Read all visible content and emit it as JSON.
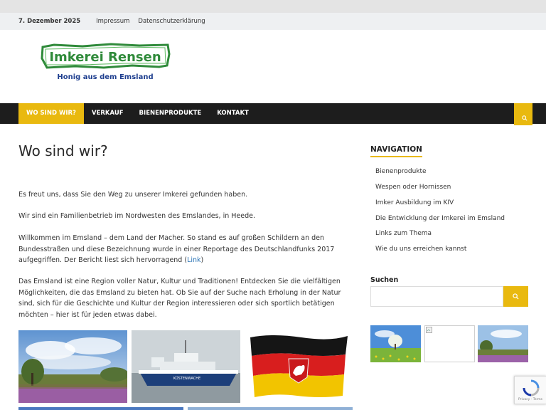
{
  "topbar": {
    "date": "7. Dezember 2025",
    "links": [
      "Impressum",
      "Datenschutzerklärung"
    ]
  },
  "logo": {
    "name": "Imkerei Rensen",
    "tagline": "Honig aus dem Emsland"
  },
  "nav": {
    "items": [
      "WO SIND WIR?",
      "VERKAUF",
      "BIENENPRODUKTE",
      "KONTAKT"
    ],
    "active_index": 0
  },
  "main": {
    "title": "Wo sind wir?",
    "p1": "Es freut uns, dass Sie den Weg zu unserer Imkerei gefunden haben.",
    "p2": "Wir sind ein Familienbetrieb im Nordwesten des Emslandes, in Heede.",
    "p3": "Willkommen im Emsland – dem Land der Macher. So stand es auf großen Schildern an den Bundesstraßen und diese Bezeichnung wurde in einer Reportage des Deutschlandfunks 2017 aufgegriffen. Der Bericht liest sich hervorragend (",
    "p3_link": "Link",
    "p3_end": ")",
    "p4": "Das Emsland ist eine Region voller Natur, Kultur und Traditionen! Entdecken Sie die vielfältigen Möglichkeiten, die das Emsland zu bieten hat. Ob Sie auf der Suche nach Erholung in der Natur sind, sich für die Geschichte und Kultur der Region interessieren oder sich sportlich betätigen möchten – hier ist für jeden etwas dabei.",
    "ship_label": "KÜSTENWACHE"
  },
  "sidebar": {
    "nav_title": "NAVIGATION",
    "links": [
      "Bienenprodukte",
      "Wespen oder Hornissen",
      "Imker Ausbildung im KIV",
      "Die Entwicklung der Imkerei im Emsland",
      "Links zum Thema",
      "Wie du uns erreichen kannst"
    ],
    "search_label": "Suchen",
    "search_placeholder": ""
  },
  "recaptcha": {
    "text": "Privacy - Terms"
  },
  "colors": {
    "accent": "#e9b90f",
    "nav_bg": "#1d1d1d",
    "topbar_bg": "#eef0f2",
    "link": "#2a73b5",
    "logo_green": "#2f8a3a",
    "logo_blue": "#1f3f8f"
  }
}
